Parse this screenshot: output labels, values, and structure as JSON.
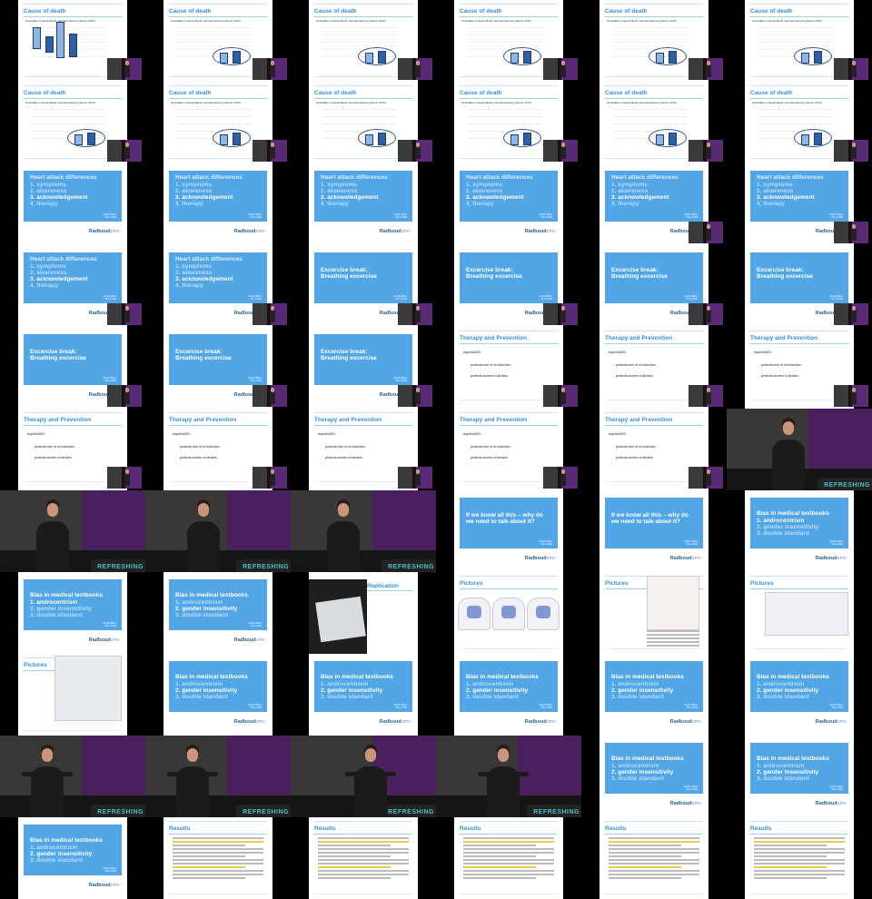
{
  "slide_titles": {
    "cause_of_death": "Cause of death",
    "heart_attack": "Heart attack differences",
    "exercise": "Excercise break:",
    "exercise2": "Breathing excercise",
    "therapy": "Therapy and Prevention",
    "why": "If we know all this – why do",
    "why2": "we need to talk about it?",
    "bias": "Bias in medical textbooks",
    "pictures": "Pictures",
    "replication": "Replication",
    "results": "Results"
  },
  "heart_items": [
    "1. symptoms",
    "2. awareness",
    "3. acknowledgement",
    "4. therapy"
  ],
  "bias_items": [
    "1. androcentrism",
    "2. gender insensitivity",
    "3. double standard"
  ],
  "therapy_lines": [
    "Aspirin/ASS:",
    "protects men of re-infarction,",
    "protects women of strokes"
  ],
  "chart_sub": "Todesfälle in Deutschland nach Erkrankung (Stand: 2013)",
  "author": "Sarah Hillner",
  "date": "09.12.2018",
  "logo": "Radboud",
  "logo_suffix": "umc",
  "stage_text": "REFRESHING"
}
